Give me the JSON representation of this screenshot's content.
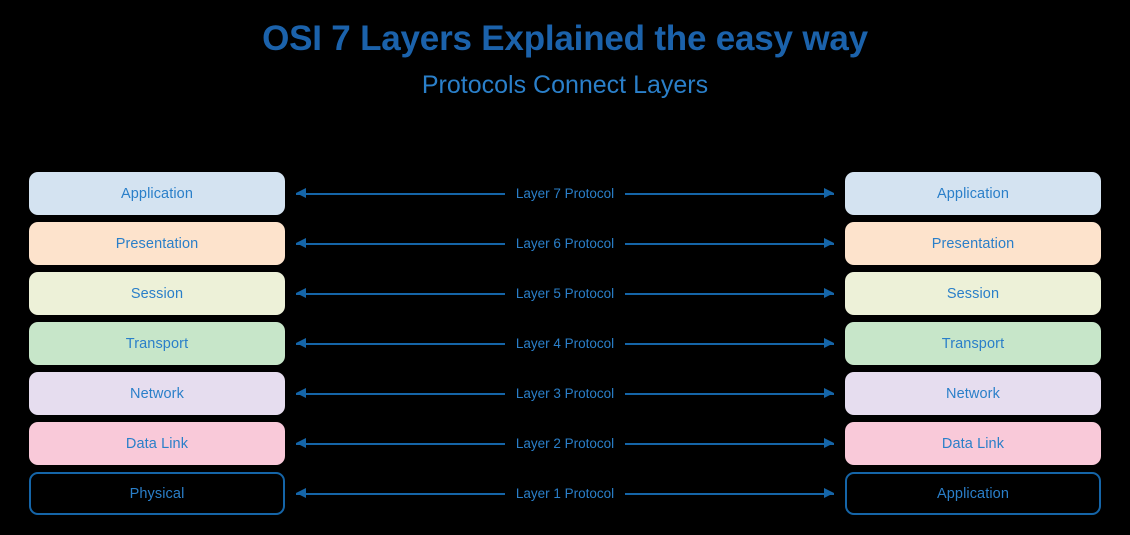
{
  "header": {
    "title": "OSI 7 Layers Explained the easy way",
    "subtitle": "Protocols Connect Layers"
  },
  "colors": {
    "background": "#000000",
    "title": "#1b62ab",
    "subtitle": "#2a7fc9",
    "label_text": "#2a7fc9",
    "line": "#1565a8",
    "application_fill": "#d4e3f1",
    "presentation_fill": "#fde3cc",
    "session_fill": "#edf1d8",
    "transport_fill": "#c7e6c9",
    "network_fill": "#e6ddef",
    "datalink_fill": "#f9c9d9",
    "physical_fill": "transparent",
    "physical_border": "#1565a8"
  },
  "rows": [
    {
      "left_label": "Application",
      "right_label": "Application",
      "protocol_label": "Layer 7 Protocol",
      "fill": "#d4e3f1",
      "outlined": false
    },
    {
      "left_label": "Presentation",
      "right_label": "Presentation",
      "protocol_label": "Layer 6 Protocol",
      "fill": "#fde3cc",
      "outlined": false
    },
    {
      "left_label": "Session",
      "right_label": "Session",
      "protocol_label": "Layer 5 Protocol",
      "fill": "#edf1d8",
      "outlined": false
    },
    {
      "left_label": "Transport",
      "right_label": "Transport",
      "protocol_label": "Layer 4 Protocol",
      "fill": "#c7e6c9",
      "outlined": false
    },
    {
      "left_label": "Network",
      "right_label": "Network",
      "protocol_label": "Layer 3 Protocol",
      "fill": "#e6ddef",
      "outlined": false
    },
    {
      "left_label": "Data Link",
      "right_label": "Data Link",
      "protocol_label": "Layer 2 Protocol",
      "fill": "#f9c9d9",
      "outlined": false
    },
    {
      "left_label": "Physical",
      "right_label": "Application",
      "protocol_label": "Layer 1 Protocol",
      "fill": "transparent",
      "outlined": true
    }
  ]
}
